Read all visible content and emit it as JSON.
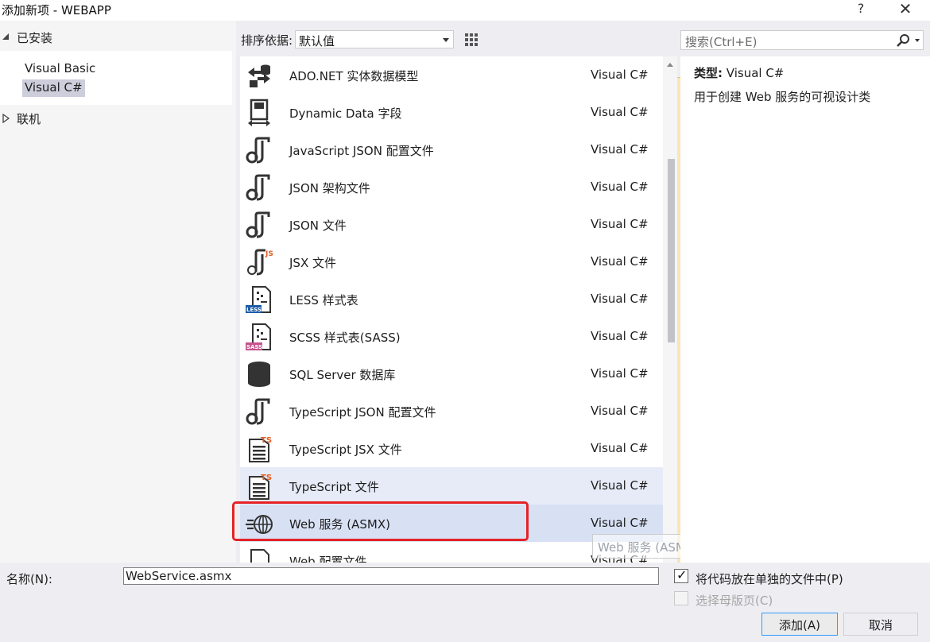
{
  "window": {
    "title": "添加新项 - WEBAPP",
    "help": "?",
    "close": "✕"
  },
  "tree": {
    "installed": "已安装",
    "children": [
      "Visual Basic",
      "Visual C#"
    ],
    "selected_index": 1,
    "online": "联机"
  },
  "toolbar": {
    "sort_label": "排序依据:",
    "sort_value": "默认值",
    "search_placeholder": "搜索(Ctrl+E)",
    "search_icon": "🔍"
  },
  "items": [
    {
      "name": "ADO.NET 实体数据模型",
      "lang": "Visual C#",
      "icon": "ado-icon"
    },
    {
      "name": "Dynamic Data 字段",
      "lang": "Visual C#",
      "icon": "dynamic-data-icon"
    },
    {
      "name": "JavaScript JSON 配置文件",
      "lang": "Visual C#",
      "icon": "json-icon"
    },
    {
      "name": "JSON 架构文件",
      "lang": "Visual C#",
      "icon": "json-icon"
    },
    {
      "name": "JSON 文件",
      "lang": "Visual C#",
      "icon": "json-icon"
    },
    {
      "name": "JSX 文件",
      "lang": "Visual C#",
      "icon": "jsx-icon"
    },
    {
      "name": "LESS 样式表",
      "lang": "Visual C#",
      "icon": "less-icon"
    },
    {
      "name": "SCSS 样式表(SASS)",
      "lang": "Visual C#",
      "icon": "sass-icon"
    },
    {
      "name": "SQL Server 数据库",
      "lang": "Visual C#",
      "icon": "database-icon"
    },
    {
      "name": "TypeScript JSON 配置文件",
      "lang": "Visual C#",
      "icon": "json-icon"
    },
    {
      "name": "TypeScript JSX 文件",
      "lang": "Visual C#",
      "icon": "ts-icon"
    },
    {
      "name": "TypeScript 文件",
      "lang": "Visual C#",
      "icon": "ts-icon"
    },
    {
      "name": "Web 服务 (ASMX)",
      "lang": "Visual C#",
      "icon": "globe-icon"
    },
    {
      "name": "Web 配置文件",
      "lang": "Visual C#",
      "icon": "file-icon"
    }
  ],
  "hover_index": 11,
  "selected_index": 12,
  "tooltip": "Web 服务 (ASMX)",
  "description": {
    "type_label": "类型:",
    "type_value": "Visual C#",
    "text": "用于创建 Web 服务的可视设计类"
  },
  "bottom": {
    "name_label": "名称(N):",
    "name_value": "WebService.asmx",
    "check1_label": "将代码放在单独的文件中(P)",
    "check1_checked": true,
    "check2_label": "选择母版页(C)",
    "check2_checked": false,
    "add_button": "添加(A)",
    "cancel_button": "取消"
  },
  "colors": {
    "highlight": "#e52226",
    "selected_row": "#d8e1f4",
    "hover_row": "#e6ebf7",
    "accent_ts": "#e35b1f",
    "less_badge": "#1c5ca8",
    "sass_badge": "#c6538c"
  }
}
